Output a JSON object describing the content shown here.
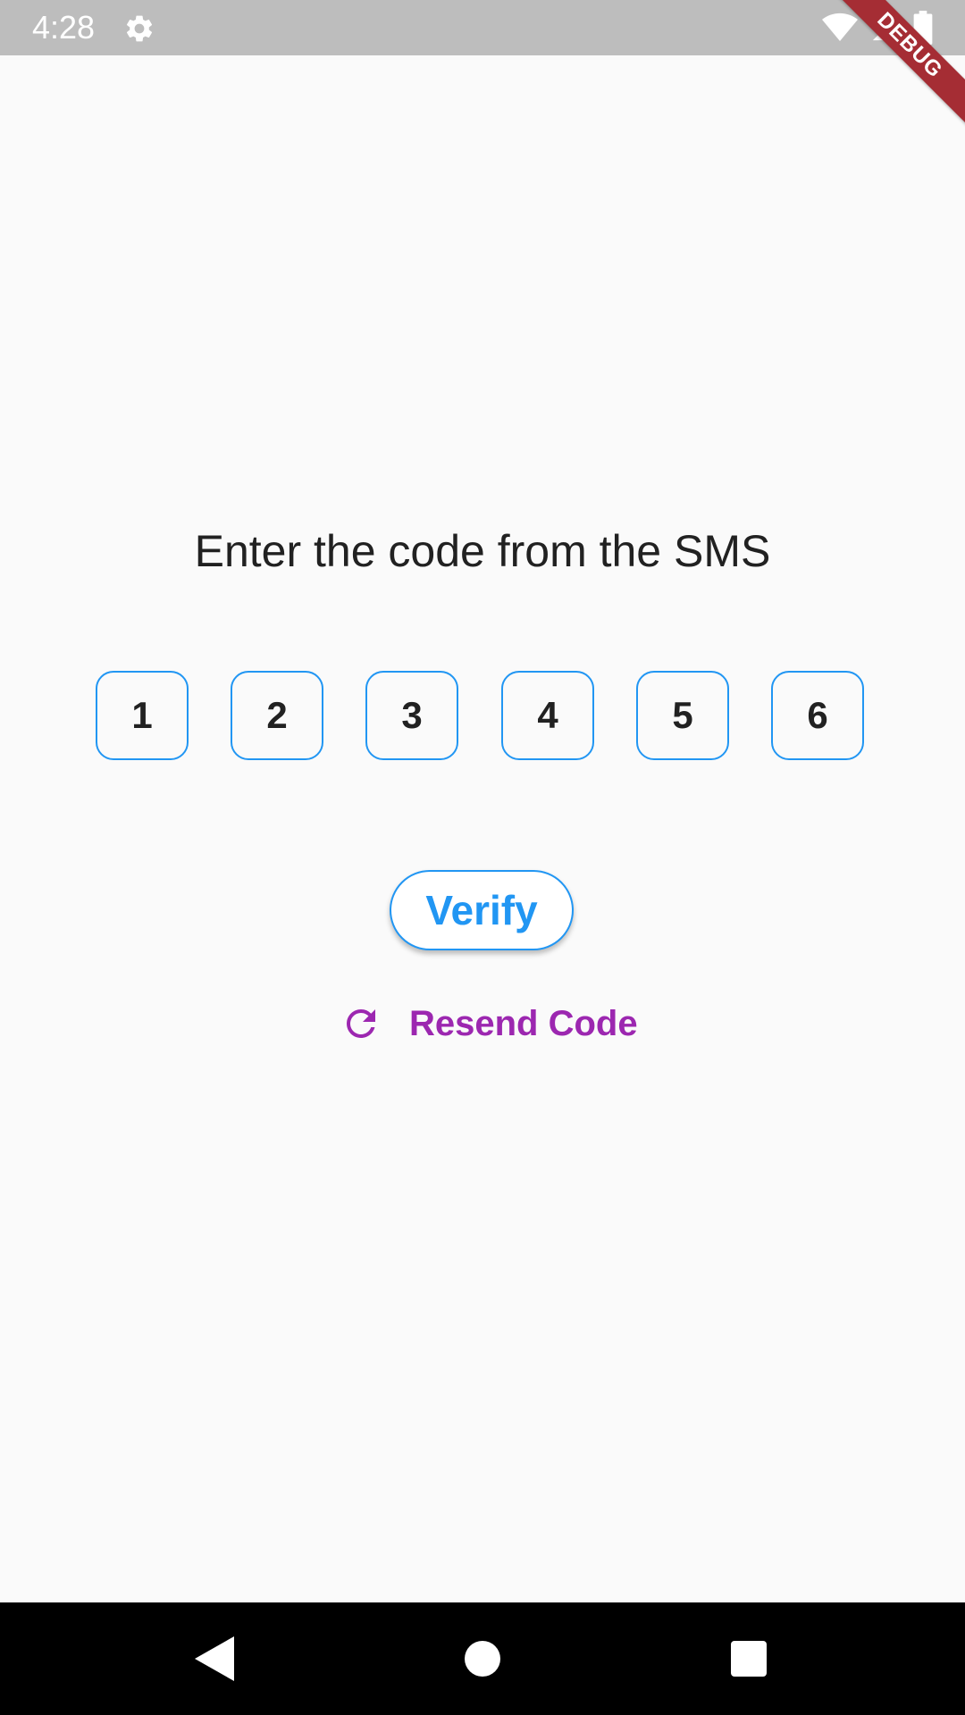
{
  "status_bar": {
    "time": "4:28",
    "icons": [
      "settings-icon",
      "wifi-icon",
      "signal-icon",
      "battery-icon"
    ]
  },
  "debug_banner": {
    "label": "DEBUG"
  },
  "headline": "Enter the code from the SMS",
  "code_digits": [
    "1",
    "2",
    "3",
    "4",
    "5",
    "6"
  ],
  "verify_button": {
    "label": "Verify"
  },
  "resend": {
    "label": "Resend Code",
    "icon": "refresh-icon"
  },
  "nav_bar": {
    "icons": [
      "back-icon",
      "home-icon",
      "recents-icon"
    ]
  },
  "colors": {
    "accent": "#2196f3",
    "resend": "#9c27b0",
    "debug_banner": "#a52d34",
    "status_bar": "#bdbdbd",
    "background": "#fafafa"
  }
}
